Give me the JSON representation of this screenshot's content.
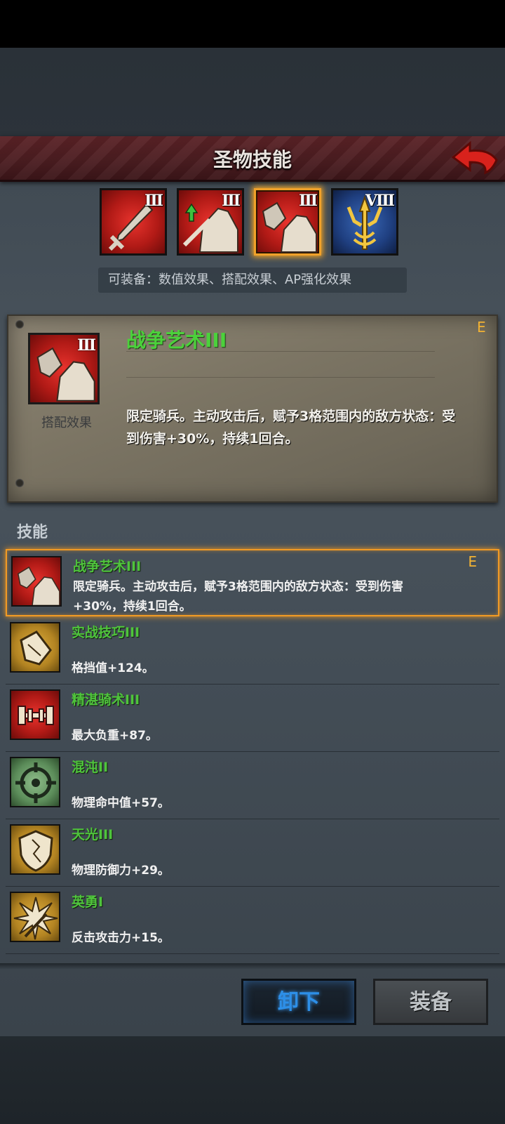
{
  "header": {
    "title": "圣物技能"
  },
  "tabs": [
    {
      "level": "III",
      "icon": "sword-icon",
      "color": "red"
    },
    {
      "level": "III",
      "icon": "horse-upgrade-icon",
      "color": "red"
    },
    {
      "level": "III",
      "icon": "gauntlet-horse-icon",
      "color": "red",
      "selected": true
    },
    {
      "level": "VIII",
      "icon": "trident-icon",
      "color": "blue"
    }
  ],
  "equip_hint": "可装备：数值效果、搭配效果、AP强化效果",
  "detail": {
    "level": "III",
    "type": "搭配效果",
    "name": "战争艺术III",
    "grade": "E",
    "description": "限定骑兵。主动攻击后，赋予3格范围内的敌方状态：受到伤害+30%，持续1回合。"
  },
  "skills_section": {
    "title": "技能",
    "items": [
      {
        "name": "战争艺术III",
        "desc": "限定骑兵。主动攻击后，赋予3格范围内的敌方状态：受到伤害+30%，持续1回合。",
        "grade": "E",
        "icon": "gauntlet-horse-icon"
      },
      {
        "name": "实战技巧III",
        "desc": "格挡值+124。",
        "icon": "gauntlet-icon"
      },
      {
        "name": "精湛骑术III",
        "desc": "最大负重+87。",
        "icon": "dumbbell-icon"
      },
      {
        "name": "混沌II",
        "desc": "物理命中值+57。",
        "icon": "crosshair-icon"
      },
      {
        "name": "天光III",
        "desc": "物理防御力+29。",
        "icon": "shield-icon"
      },
      {
        "name": "英勇I",
        "desc": "反击攻击力+15。",
        "icon": "burst-icon"
      }
    ]
  },
  "footer": {
    "unequip_label": "卸下",
    "equip_label": "装备"
  },
  "colors": {
    "skill_name": "#4fc43c",
    "grade": "#f2b233",
    "selected_border": "#f19a24",
    "unequip_text": "#2d8fe8"
  }
}
